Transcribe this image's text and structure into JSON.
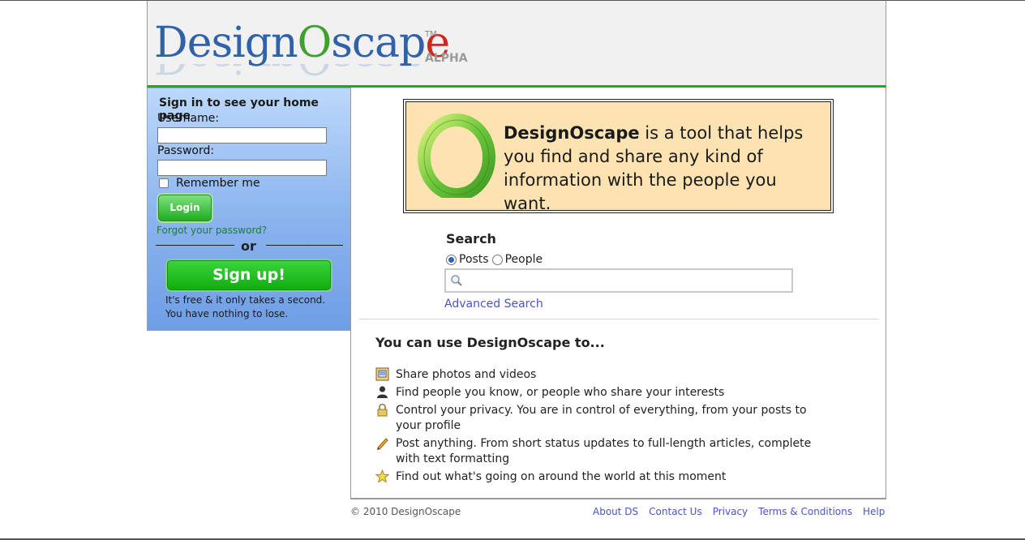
{
  "brand": {
    "name": "DesignOscape",
    "logo_parts": [
      "Design",
      "O",
      "scap",
      "e"
    ],
    "trademark": "TM",
    "stage": "ALPHA",
    "colors": {
      "blue": "#2f62a8",
      "green": "#3fa02f",
      "red": "#cc2a1c",
      "accent_line": "#1eaa1e"
    }
  },
  "signin": {
    "title": "Sign in to see your home page",
    "username_label": "Username:",
    "username_value": "",
    "password_label": "Password:",
    "password_value": "",
    "remember_label": "Remember me",
    "remember_checked": false,
    "login_label": "Login",
    "forgot_label": "Forgot your password?",
    "or_label": "or",
    "signup_label": "Sign up!",
    "note_line1": "It's free & it only takes a second.",
    "note_line2": "You have nothing to lose."
  },
  "promo": {
    "brand": "DesignOscape",
    "text": " is a tool that helps you find and share any kind of information with the people you want."
  },
  "search": {
    "title": "Search",
    "options": [
      "Posts",
      "People"
    ],
    "selected": "Posts",
    "query": "",
    "advanced_label": "Advanced Search"
  },
  "uses": {
    "title": "You can use DesignOscape to...",
    "items": [
      {
        "icon": "photos-icon",
        "text": "Share photos and videos"
      },
      {
        "icon": "person-icon",
        "text": "Find people you know, or people who share your interests"
      },
      {
        "icon": "lock-icon",
        "text": "Control your privacy. You are in control of everything, from your posts to your profile"
      },
      {
        "icon": "pencil-icon",
        "text": "Post anything. From short status updates to full-length articles, complete with text formatting"
      },
      {
        "icon": "star-icon",
        "text": "Find out what's going on around the world at this moment"
      }
    ]
  },
  "footer": {
    "copyright": "© 2010 DesignOscape",
    "links": [
      "About DS",
      "Contact Us",
      "Privacy",
      "Terms & Conditions",
      "Help"
    ]
  }
}
